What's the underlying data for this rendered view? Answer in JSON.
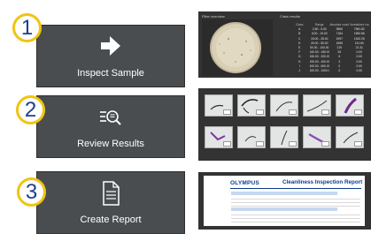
{
  "steps": [
    {
      "number": "1",
      "label": "Inspect Sample",
      "icon": "arrow-right-icon"
    },
    {
      "number": "2",
      "label": "Review Results",
      "icon": "list-magnifier-icon"
    },
    {
      "number": "3",
      "label": "Create Report",
      "icon": "document-icon"
    }
  ],
  "preview1": {
    "filter_overview": "Filter overview",
    "class_results": "Class results",
    "headers": [
      "Class",
      "Range",
      "Absolute count",
      "Normalized count (1/Number of seeded parts)"
    ],
    "rows": [
      [
        "A",
        "2.50 - 5.00",
        "3960",
        "7981.82"
      ],
      [
        "B",
        "5.00 - 15.00",
        "7184",
        "1552.66"
      ],
      [
        "C",
        "15.00 - 25.00",
        "1997",
        "1302.25"
      ],
      [
        "D",
        "25.00 - 50.00",
        "1069",
        "131.60"
      ],
      [
        "E",
        "50.00 - 100.00",
        "219",
        "21.31"
      ],
      [
        "F",
        "100.00 - 150.00",
        "25",
        "0.00"
      ],
      [
        "G",
        "150.00 - 200.00",
        "6",
        "0.00"
      ],
      [
        "H",
        "200.00 - 400.00",
        "3",
        "0.00"
      ],
      [
        "I",
        "400.00 - 600.00",
        "0",
        "0.00"
      ],
      [
        "J",
        "600.00 - 1000.00",
        "0",
        "0.00"
      ]
    ]
  },
  "preview3": {
    "logo": "OLYMPUS",
    "title": "Cleanliness Inspection Report"
  },
  "colors": {
    "badge_border": "#f1c40f",
    "badge_text": "#1f3f8a",
    "tile_bg": "#4a4d50",
    "preview_bg": "#333333",
    "report_blue": "#0c3a8c"
  }
}
